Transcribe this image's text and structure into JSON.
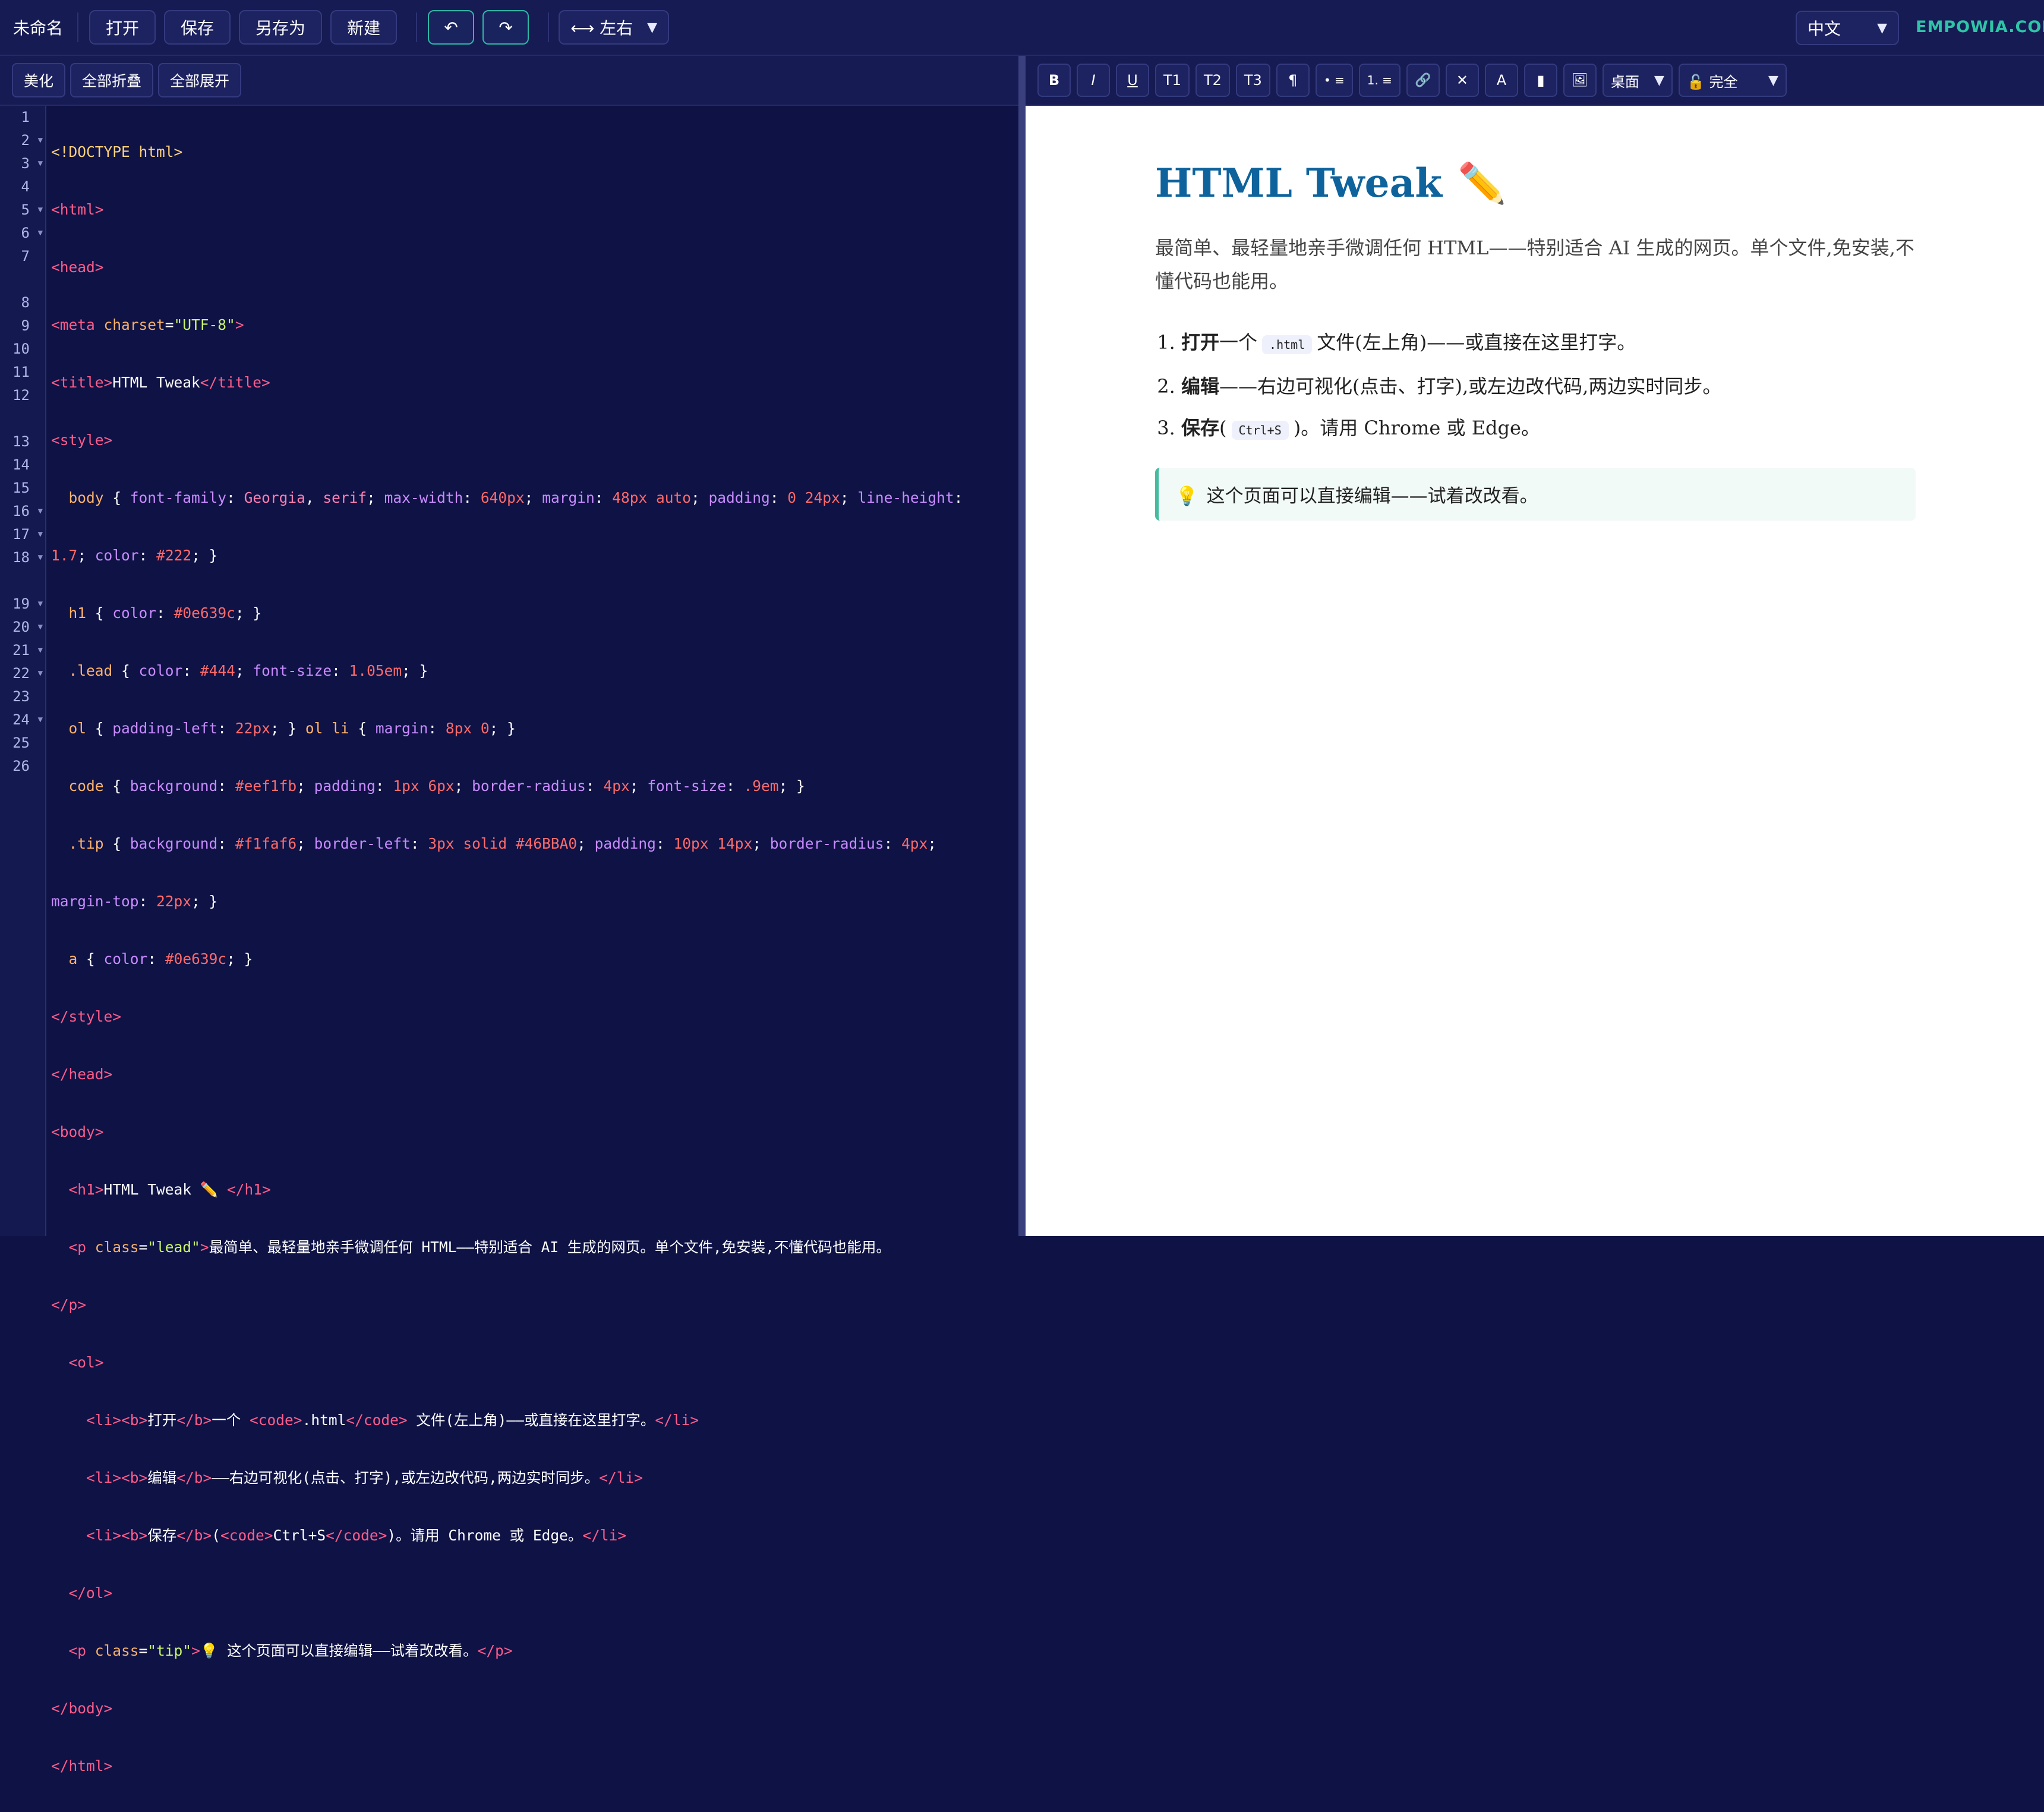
{
  "topbar": {
    "doc_title": "未命名",
    "open": "打开",
    "save": "保存",
    "save_as": "另存为",
    "new": "新建",
    "undo": "↶",
    "redo": "↷",
    "layout": "⟷ 左右",
    "language": "中文",
    "brand": "EMPOWIA.COM"
  },
  "left_tools": {
    "beautify": "美化",
    "fold_all": "全部折叠",
    "unfold_all": "全部展开"
  },
  "format_bar": {
    "bold": "B",
    "italic": "I",
    "underline": "U",
    "h1": "T1",
    "h2": "T2",
    "h3": "T3",
    "paragraph": "¶",
    "ul": "• ≡",
    "ol": "1. ≡",
    "link": "🔗",
    "clear": "✕",
    "font_color": "A",
    "bg": "▮",
    "image": "🖼",
    "device": "桌面",
    "mode": "🔓 完全"
  },
  "gutter": [
    "1",
    "2",
    "3",
    "4",
    "5",
    "6",
    "7",
    "8",
    "9",
    "10",
    "11",
    "12",
    "13",
    "14",
    "15",
    "16",
    "17",
    "18",
    "19",
    "20",
    "21",
    "22",
    "23",
    "24",
    "25",
    "26"
  ],
  "code": {
    "l1": "<!DOCTYPE html>",
    "l2": "<html>",
    "l3": "<head>",
    "l4a": "<meta ",
    "l4b": "charset",
    "l4c": "=",
    "l4d": "\"UTF-8\"",
    "l4e": ">",
    "l5a": "<title>",
    "l5b": "HTML Tweak",
    "l5c": "</title>",
    "l6": "<style>",
    "l7_1": "  body",
    "l7_2": " { ",
    "l7_3": "font-family",
    "l7_4": ": ",
    "l7_5": "Georgia",
    "l7_6": ", ",
    "l7_7": "serif",
    "l7_8": "; ",
    "l7_9": "max-width",
    "l7_10": ": ",
    "l7_11": "640px",
    "l7_12": "; ",
    "l7_13": "margin",
    "l7_14": ": ",
    "l7_15": "48px auto",
    "l7_16": "; ",
    "l7_17": "padding",
    "l7_18": ": ",
    "l7_19": "0 24px",
    "l7_20": "; ",
    "l7_21": "line-height",
    "l7_22": ":",
    "l7w_1": "1.7",
    "l7w_2": "; ",
    "l7w_3": "color",
    "l7w_4": ": ",
    "l7w_5": "#222",
    "l7w_6": "; }",
    "l8_1": "  h1",
    "l8_2": " { ",
    "l8_3": "color",
    "l8_4": ": ",
    "l8_5": "#0e639c",
    "l8_6": "; }",
    "l9_1": "  .lead",
    "l9_2": " { ",
    "l9_3": "color",
    "l9_4": ": ",
    "l9_5": "#444",
    "l9_6": "; ",
    "l9_7": "font-size",
    "l9_8": ": ",
    "l9_9": "1.05em",
    "l9_10": "; }",
    "l10_1": "  ol",
    "l10_2": " { ",
    "l10_3": "padding-left",
    "l10_4": ": ",
    "l10_5": "22px",
    "l10_6": "; } ",
    "l10_7": "ol li",
    "l10_8": " { ",
    "l10_9": "margin",
    "l10_10": ": ",
    "l10_11": "8px 0",
    "l10_12": "; }",
    "l11_1": "  code",
    "l11_2": " { ",
    "l11_3": "background",
    "l11_4": ": ",
    "l11_5": "#eef1fb",
    "l11_6": "; ",
    "l11_7": "padding",
    "l11_8": ": ",
    "l11_9": "1px 6px",
    "l11_10": "; ",
    "l11_11": "border-radius",
    "l11_12": ": ",
    "l11_13": "4px",
    "l11_14": "; ",
    "l11_15": "font-size",
    "l11_16": ": ",
    "l11_17": ".9em",
    "l11_18": "; }",
    "l12_1": "  .tip",
    "l12_2": " { ",
    "l12_3": "background",
    "l12_4": ": ",
    "l12_5": "#f1faf6",
    "l12_6": "; ",
    "l12_7": "border-left",
    "l12_8": ": ",
    "l12_9": "3px solid #46BBA0",
    "l12_10": "; ",
    "l12_11": "padding",
    "l12_12": ": ",
    "l12_13": "10px 14px",
    "l12_14": "; ",
    "l12_15": "border-radius",
    "l12_16": ": ",
    "l12_17": "4px",
    "l12_18": ";",
    "l12w_1": "margin-top",
    "l12w_2": ": ",
    "l12w_3": "22px",
    "l12w_4": "; }",
    "l13_1": "  a",
    "l13_2": " { ",
    "l13_3": "color",
    "l13_4": ": ",
    "l13_5": "#0e639c",
    "l13_6": "; }",
    "l14": "</style>",
    "l15": "</head>",
    "l16": "<body>",
    "l17a": "  <h1>",
    "l17b": "HTML Tweak ✏️ ",
    "l17c": "</h1>",
    "l18a": "  <p ",
    "l18b": "class",
    "l18c": "=",
    "l18d": "\"lead\"",
    "l18e": ">",
    "l18f": "最简单、最轻量地亲手微调任何 HTML——特别适合 AI 生成的网页。单个文件,免安装,不懂代码也能用。",
    "l18w": "</p>",
    "l19": "  <ol>",
    "l20a": "    <li><b>",
    "l20b": "打开",
    "l20c": "</b>",
    "l20d": "一个 ",
    "l20e": "<code>",
    "l20f": ".html",
    "l20g": "</code>",
    "l20h": " 文件(左上角)——或直接在这里打字。",
    "l20i": "</li>",
    "l21a": "    <li><b>",
    "l21b": "编辑",
    "l21c": "</b>",
    "l21d": "——右边可视化(点击、打字),或左边改代码,两边实时同步。",
    "l21e": "</li>",
    "l22a": "    <li><b>",
    "l22b": "保存",
    "l22c": "</b>",
    "l22d": "(",
    "l22e": "<code>",
    "l22f": "Ctrl+S",
    "l22g": "</code>",
    "l22h": ")。请用 Chrome 或 Edge。",
    "l22i": "</li>",
    "l23": "  </ol>",
    "l24a": "  <p ",
    "l24b": "class",
    "l24c": "=",
    "l24d": "\"tip\"",
    "l24e": ">",
    "l24f": "💡 这个页面可以直接编辑——试着改改看。",
    "l24g": "</p>",
    "l25": "</body>",
    "l26": "</html>"
  },
  "preview": {
    "h1": "HTML Tweak",
    "h1_icon": "✏️",
    "lead": "最简单、最轻量地亲手微调任何 HTML——特别适合 AI 生成的网页。单个文件,免安装,不懂代码也能用。",
    "li1_b": "打开",
    "li1_t1": "一个",
    "li1_code": ".html",
    "li1_t2": "文件(左上角)——或直接在这里打字。",
    "li2_b": "编辑",
    "li2_t": "——右边可视化(点击、打字),或左边改代码,两边实时同步。",
    "li3_b": "保存",
    "li3_t1": "(",
    "li3_code": "Ctrl+S",
    "li3_t2": ")。请用 Chrome 或 Edge。",
    "tip_icon": "💡",
    "tip": "这个页面可以直接编辑——试着改改看。"
  },
  "colors": {
    "accent_teal": "#2fc4a8",
    "code_bg": "#0e1245",
    "heading_blue": "#0e639c",
    "tip_border": "#46BBA0"
  }
}
